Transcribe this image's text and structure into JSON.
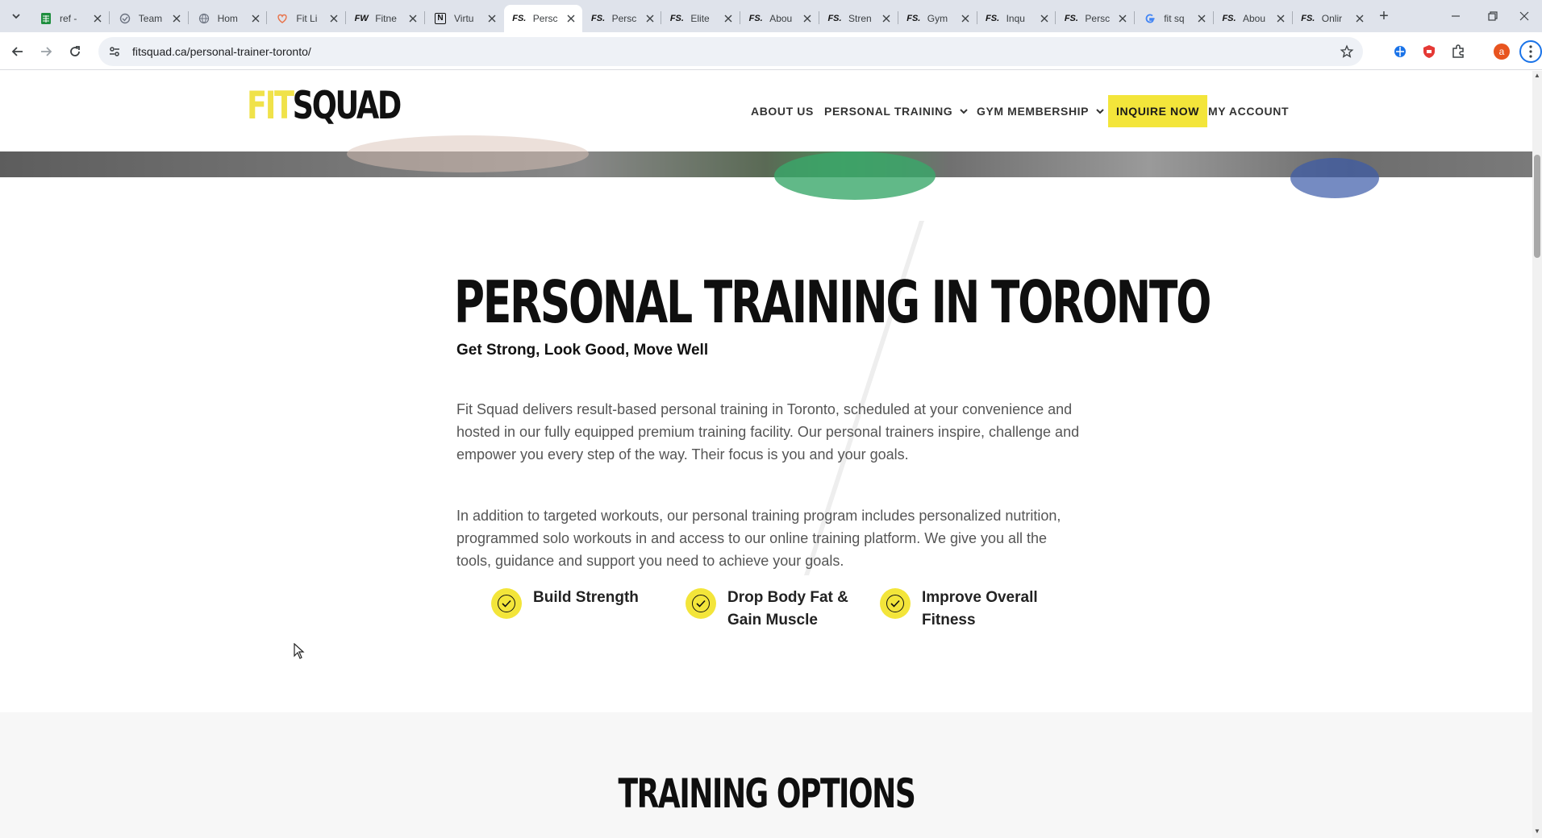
{
  "browser": {
    "tabs": [
      {
        "title": "ref -",
        "favicon": "sheets-icon",
        "fav_color": "#1e8e3e"
      },
      {
        "title": "Team",
        "favicon": "team-icon",
        "fav_color": "#6b7280"
      },
      {
        "title": "Hom",
        "favicon": "globe-icon",
        "fav_color": "#6b7280"
      },
      {
        "title": "Fit Li",
        "favicon": "heart-icon",
        "fav_color": "#e8734a"
      },
      {
        "title": "Fitne",
        "favicon": "FW",
        "fav_color": "#111111"
      },
      {
        "title": "Virtu",
        "favicon": "N",
        "fav_color": "#111111"
      },
      {
        "title": "Persc",
        "favicon": "FS.",
        "fav_color": "#111111"
      },
      {
        "title": "Persc",
        "favicon": "FS.",
        "fav_color": "#111111"
      },
      {
        "title": "Elite",
        "favicon": "FS.",
        "fav_color": "#111111"
      },
      {
        "title": "Abou",
        "favicon": "FS.",
        "fav_color": "#111111"
      },
      {
        "title": "Stren",
        "favicon": "FS.",
        "fav_color": "#111111"
      },
      {
        "title": "Gym",
        "favicon": "FS.",
        "fav_color": "#111111"
      },
      {
        "title": "Inqu",
        "favicon": "FS.",
        "fav_color": "#111111"
      },
      {
        "title": "Persc",
        "favicon": "FS.",
        "fav_color": "#111111"
      },
      {
        "title": "fit sq",
        "favicon": "G",
        "fav_color": "#4285f4"
      },
      {
        "title": "Abou",
        "favicon": "FS.",
        "fav_color": "#111111"
      },
      {
        "title": "Onlir",
        "favicon": "FS.",
        "fav_color": "#111111"
      }
    ],
    "active_tab_index": 6,
    "url": "fitsquad.ca/personal-trainer-toronto/",
    "profile_initial": "a"
  },
  "site": {
    "logo": {
      "fit": "FIT",
      "squad": "SQUAD"
    },
    "nav": {
      "about": "ABOUT US",
      "personal_training": "PERSONAL TRAINING",
      "gym_membership": "GYM MEMBERSHIP",
      "inquire": "INQUIRE NOW",
      "account": "MY ACCOUNT"
    },
    "accent_color": "#f3e53a"
  },
  "main": {
    "title": "PERSONAL TRAINING IN TORONTO",
    "subtitle": "Get Strong, Look Good, Move Well",
    "paragraph1": "Fit Squad delivers result-based personal training in Toronto, scheduled at your convenience and hosted in our fully equipped premium training facility. Our personal trainers inspire, challenge and empower you every step of the way. Their focus is you and your goals.",
    "paragraph2": "In addition to targeted workouts, our personal training program includes personalized nutrition, programmed solo workouts in and access to our online training platform. We give you all the tools, guidance and support you need to achieve your goals.",
    "features": [
      {
        "line1": "Build Strength",
        "line2": ""
      },
      {
        "line1": "Drop Body Fat &",
        "line2": "Gain Muscle"
      },
      {
        "line1": "Improve Overall",
        "line2": "Fitness"
      }
    ],
    "options_title": "TRAINING OPTIONS"
  }
}
